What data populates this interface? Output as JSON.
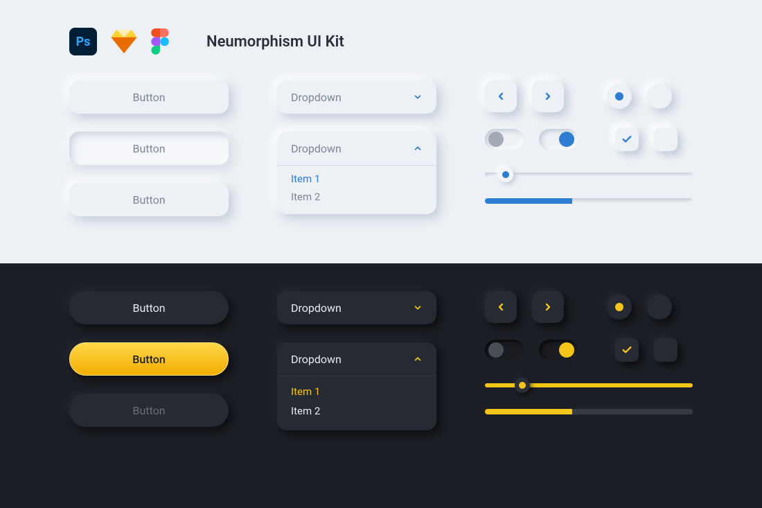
{
  "title": "Neumorphism UI Kit",
  "app_icons": {
    "ps": "Ps",
    "sketch": "sketch",
    "figma": "figma"
  },
  "colors": {
    "light_bg": "#edf0f4",
    "dark_bg": "#1d1f26",
    "accent_blue": "#2d7dd2",
    "accent_yellow": "#f5c518"
  },
  "light": {
    "buttons": [
      "Button",
      "Button",
      "Button"
    ],
    "dropdown_closed": {
      "label": "Dropdown",
      "open": false
    },
    "dropdown_open": {
      "label": "Dropdown",
      "open": true,
      "items": [
        "Item 1",
        "Item 2"
      ],
      "selected": 0
    },
    "prev_next": {
      "prev": "left",
      "next": "right"
    },
    "radios": {
      "selected": 0,
      "count": 2
    },
    "toggles": {
      "off": false,
      "on": true
    },
    "checkbox": {
      "checked": true,
      "unchecked": false
    },
    "slider_value": 10,
    "progress_value": 42
  },
  "dark": {
    "buttons": [
      {
        "label": "Button",
        "variant": "default"
      },
      {
        "label": "Button",
        "variant": "active"
      },
      {
        "label": "Button",
        "variant": "disabled"
      }
    ],
    "dropdown_closed": {
      "label": "Dropdown",
      "open": false
    },
    "dropdown_open": {
      "label": "Dropdown",
      "open": true,
      "items": [
        "Item 1",
        "Item 2"
      ],
      "selected": 0
    },
    "prev_next": {
      "prev": "left",
      "next": "right"
    },
    "radios": {
      "selected": 0,
      "count": 2
    },
    "toggles": {
      "off": false,
      "on": true
    },
    "checkbox": {
      "checked": true,
      "unchecked": false
    },
    "slider_value": 18,
    "progress_value": 42
  }
}
